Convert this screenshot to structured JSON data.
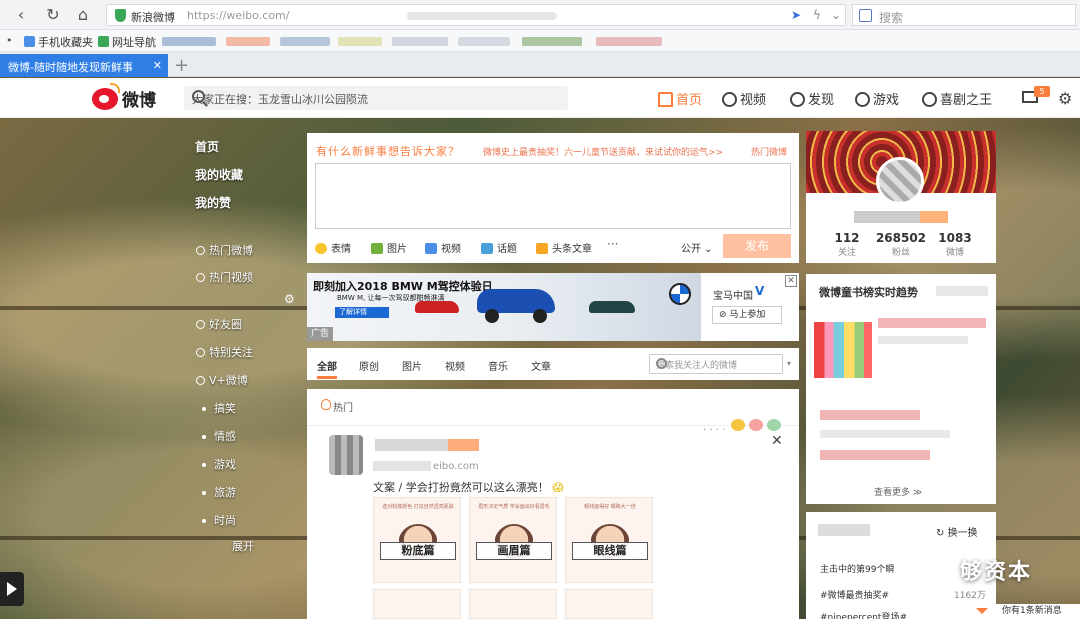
{
  "browser": {
    "secure_label": "新浪微博",
    "url": "https://weibo.com/",
    "search_placeholder": "搜索",
    "bookmarks": [
      "手机收藏夹",
      "网址导航"
    ],
    "tab_title": "微博-随时随地发现新鲜事",
    "colors": {
      "tab_active": "#2f7ee6",
      "secure": "#3aa757"
    }
  },
  "weibo_nav": {
    "logo": "微博",
    "search_placeholder": "大家正在搜：玉龙雪山冰川公园陨流",
    "links": [
      "首页",
      "视频",
      "发现",
      "游戏",
      "喜剧之王"
    ],
    "mail_badge": "5",
    "icons": [
      "home-icon",
      "video-icon",
      "discover-icon",
      "game-icon",
      "user-icon",
      "mail-icon",
      "gear-icon"
    ],
    "accent": "#fa7d3c"
  },
  "left_nav": {
    "main": [
      "首页",
      "我的收藏",
      "我的赞"
    ],
    "hot": [
      "热门微博",
      "热门视频"
    ],
    "groups": [
      "好友圈",
      "特别关注",
      "V+微博"
    ],
    "categories": [
      "搞笑",
      "情感",
      "游戏",
      "旅游",
      "时尚"
    ],
    "expand": "展开"
  },
  "composer": {
    "title": "有什么新鲜事想告诉大家？",
    "promo": "微博史上最贵抽奖！六一儿童节送贡献，来试试你的运气>>",
    "hot_topic": "热门微博",
    "tools": [
      "表情",
      "图片",
      "视频",
      "话题",
      "头条文章"
    ],
    "more": "···",
    "visibility": "公开",
    "send": "发布"
  },
  "ad": {
    "headline": "即刻加入2018 BMW M驾控体验日",
    "sub": "BMW M, 让每一次驾驭都酣畅淋漓",
    "cta": "了解详情",
    "label": "广告",
    "brand": "宝马中国",
    "join": "马上参加"
  },
  "feed_tabs": {
    "tabs": [
      "全部",
      "原创",
      "图片",
      "视频",
      "音乐",
      "文章"
    ],
    "search_placeholder": "搜索我关注人的微博",
    "more": "▾"
  },
  "post": {
    "section": "热门",
    "source_domain": "eibo.com",
    "text": "文案 / 学会打扮竟然可以这么漂亮！",
    "images": [
      {
        "tag": "粉底篇",
        "caption": "选对粉底颜色 打造自然透亮肌肤"
      },
      {
        "tag": "画眉篇",
        "caption": "眉形决定气质 学会画出好看眉毛"
      },
      {
        "tag": "眼线篇",
        "caption": "眼线画得好 眼睛大一倍"
      }
    ]
  },
  "profile": {
    "stats": [
      {
        "value": "112",
        "label": "关注"
      },
      {
        "value": "268502",
        "label": "粉丝"
      },
      {
        "value": "1083",
        "label": "微博"
      }
    ]
  },
  "bookbox": {
    "title": "微博童书榜实时趋势",
    "more": "查看更多"
  },
  "topics": {
    "refresh": "换一换",
    "rows": [
      "主击中的第99个瞬",
      "#微博最贵抽奖#",
      "#ninepercent登场#"
    ],
    "count": "1162万"
  },
  "watermark": "够资本",
  "popup": "你有1条新消息"
}
